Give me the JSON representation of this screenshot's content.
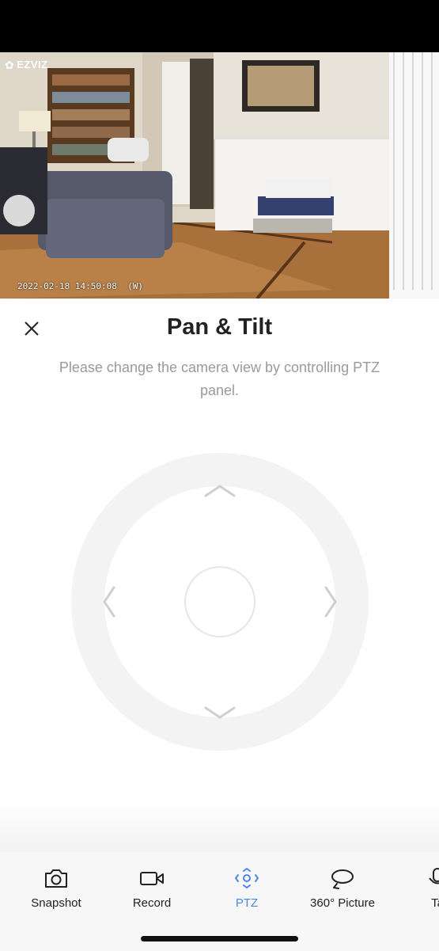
{
  "camera": {
    "brand": "EZVIZ",
    "timestamp": "2022-02-18 14:50:08  (W)"
  },
  "ptz": {
    "title": "Pan & Tilt",
    "hint": "Please change the camera view by controlling PTZ panel."
  },
  "toolbar": {
    "items": [
      {
        "label": "Snapshot",
        "icon": "camera-icon"
      },
      {
        "label": "Record",
        "icon": "video-camera-icon"
      },
      {
        "label": "PTZ",
        "icon": "ptz-icon",
        "active": true
      },
      {
        "label": "360° Picture",
        "icon": "rotate-icon"
      },
      {
        "label": "Ta",
        "icon": "microphone-icon"
      }
    ]
  },
  "colors": {
    "accent": "#4a86e8",
    "text": "#222222",
    "hint": "#9a9a9a",
    "dpad_ring": "#f3f3f3"
  }
}
